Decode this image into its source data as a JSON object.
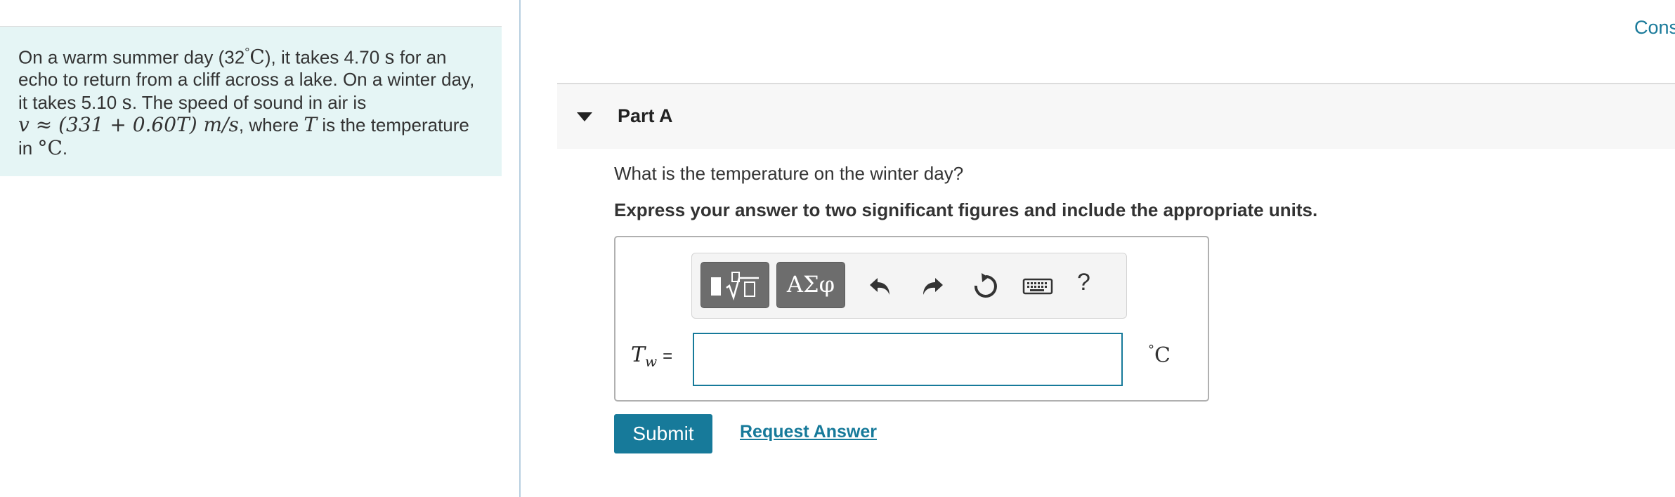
{
  "problem": {
    "line1_text": "On a warm summer day (32",
    "line1_deg": "°",
    "line1_unit": "C",
    "line1_mid": "), it takes 4.70",
    "line1_s": "s",
    "line1_end": "for an",
    "line2": "echo to return from a cliff across a lake. On a winter day,",
    "line3_start": "it takes 5.10",
    "line3_s": "s",
    "line3_end": ". The speed of sound in air is",
    "line4_formula": "v ≈ (331 + 0.60T) m/s",
    "line4_mid": ", where",
    "line4_T": "T",
    "line4_end": "is the temperature",
    "line5_start": "in",
    "line5_unit": "°C",
    "line5_end": "."
  },
  "header": {
    "cons_link": "Cons"
  },
  "part": {
    "title": "Part A"
  },
  "question": "What is the temperature on the winter day?",
  "instructions": "Express your answer to two significant figures and include the appropriate units.",
  "toolbar": {
    "greek_label": "ΑΣφ",
    "help_label": "?",
    "icons": [
      "templates-icon",
      "greek-symbols-icon",
      "undo-icon",
      "redo-icon",
      "reset-icon",
      "keyboard-icon",
      "help-icon"
    ]
  },
  "answer": {
    "variable": "T",
    "subscript": "w",
    "equals": "=",
    "value": "",
    "unit_deg": "°",
    "unit_letter": "C"
  },
  "actions": {
    "submit_label": "Submit",
    "request_label": "Request Answer"
  },
  "colors": {
    "accent": "#177a9a",
    "problem_bg": "#e5f5f5",
    "header_bg": "#f7f7f7"
  }
}
